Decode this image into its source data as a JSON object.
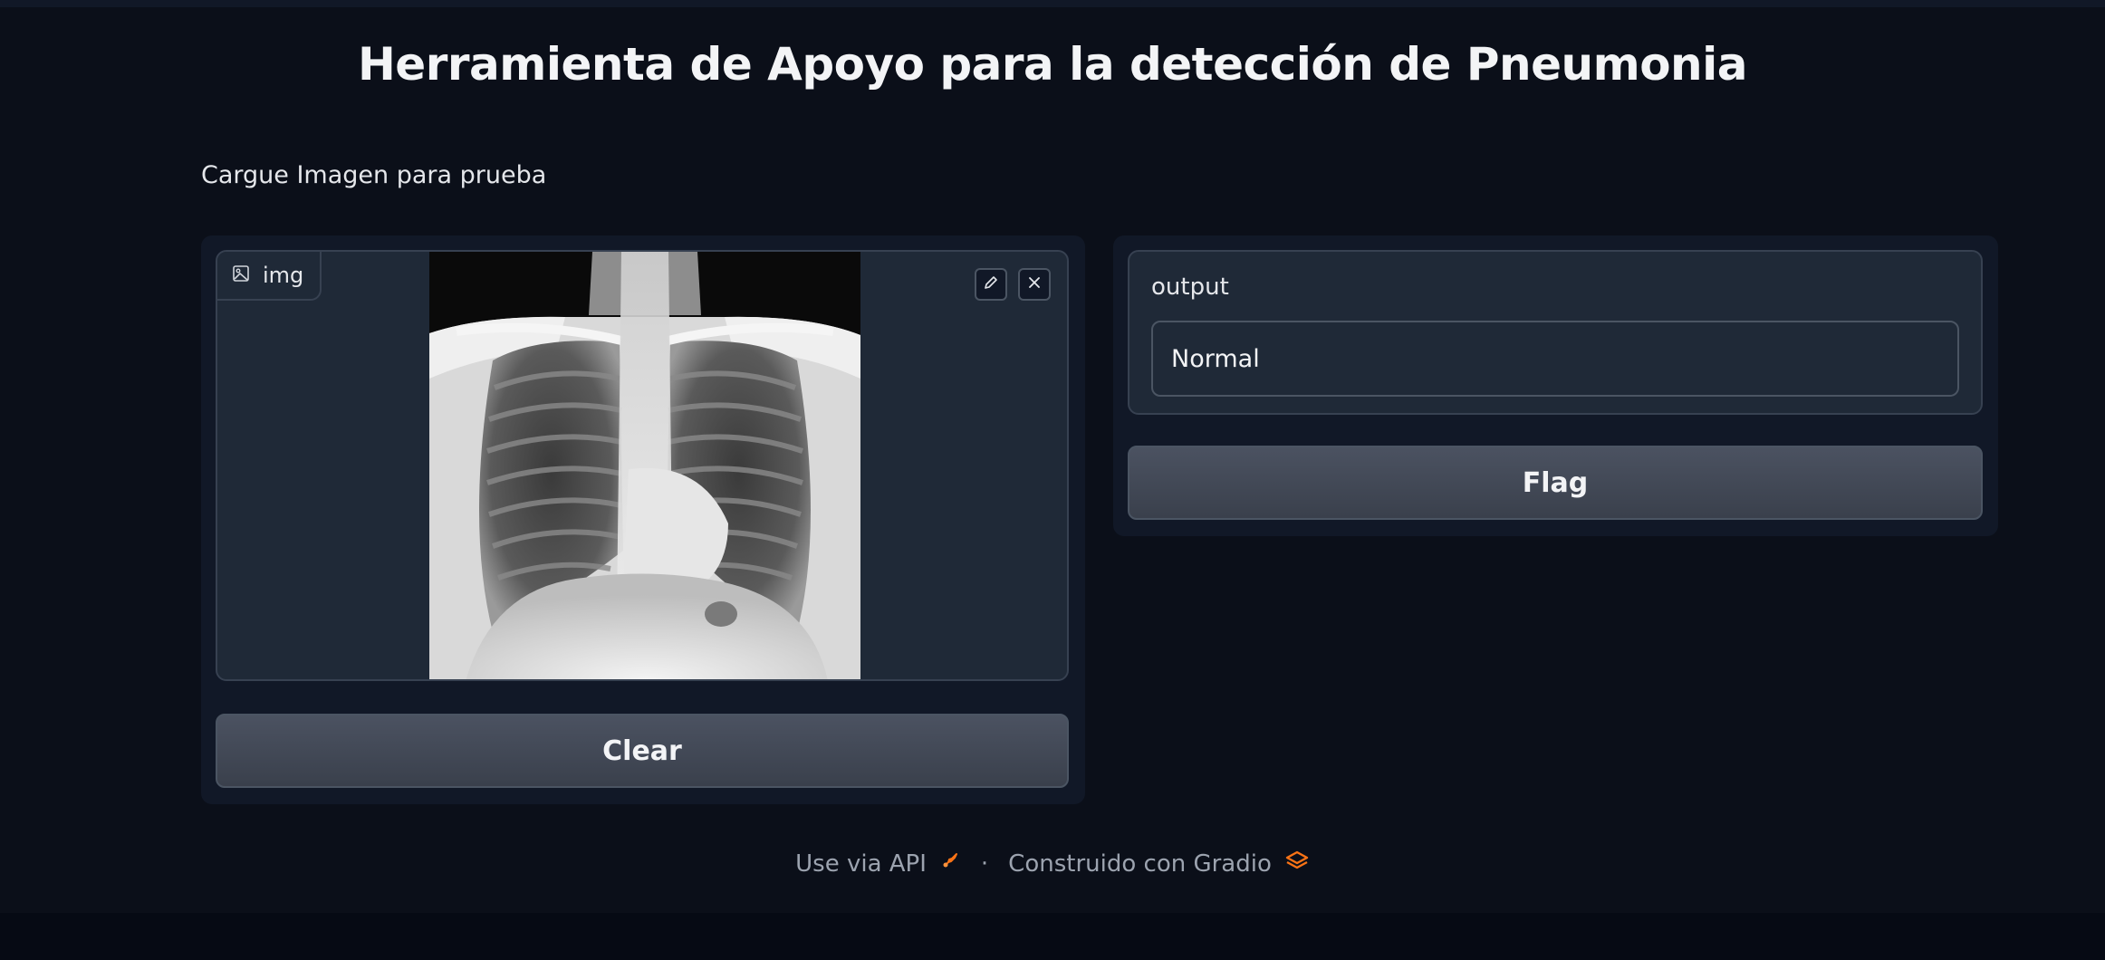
{
  "header": {
    "title": "Herramienta de Apoyo para la detección de Pneumonia"
  },
  "description": "Cargue Imagen para prueba",
  "input_image": {
    "label": "img",
    "icon": "image-icon",
    "edit_icon": "pencil-icon",
    "close_icon": "close-icon"
  },
  "buttons": {
    "clear": "Clear",
    "flag": "Flag"
  },
  "output": {
    "label": "output",
    "value": "Normal"
  },
  "footer": {
    "api_link": "Use via API",
    "separator": "·",
    "built_with": "Construido con Gradio"
  },
  "colors": {
    "background": "#0b0f19",
    "panel": "#111827",
    "block": "#1f2937",
    "accent": "#f97316"
  }
}
